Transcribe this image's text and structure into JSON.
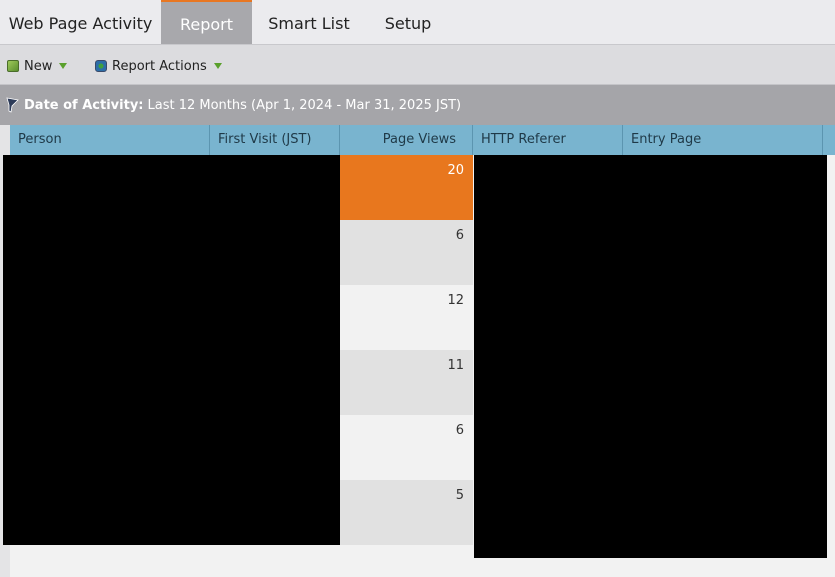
{
  "tabs": [
    {
      "label": "Web Page Activity",
      "active": false
    },
    {
      "label": "Report",
      "active": true
    },
    {
      "label": "Smart List",
      "active": false
    },
    {
      "label": "Setup",
      "active": false
    }
  ],
  "toolbar": {
    "new_label": "New",
    "report_actions_label": "Report Actions"
  },
  "filter": {
    "label": "Date of Activity:",
    "value": "Last 12 Months (Apr 1, 2024 - Mar 31, 2025 JST)"
  },
  "table": {
    "columns": [
      "Person",
      "First Visit (JST)",
      "Page Views",
      "HTTP Referer",
      "Entry Page"
    ],
    "page_views": [
      "20",
      "6",
      "12",
      "11",
      "6",
      "5"
    ]
  },
  "colors": {
    "accent": "#e8771e",
    "header": "#79b4cf"
  }
}
